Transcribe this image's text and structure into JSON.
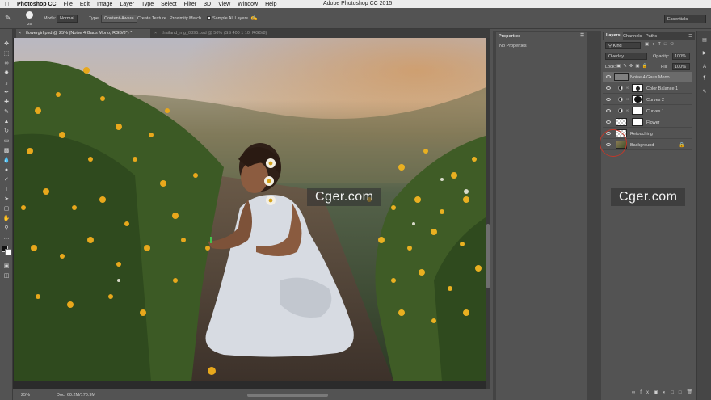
{
  "menubar": {
    "app_name": "Photoshop CC",
    "menus": [
      "File",
      "Edit",
      "Image",
      "Layer",
      "Type",
      "Select",
      "Filter",
      "3D",
      "View",
      "Window",
      "Help"
    ],
    "window_title": "Adobe Photoshop CC 2015"
  },
  "options": {
    "brush_size": "25",
    "mode_label": "Mode:",
    "mode_value": "Normal",
    "type_label": "Type:",
    "type_value": "Content-Aware",
    "create_texture": "Create Texture",
    "proximity_match": "Proximity Match",
    "sample_all_layers": "Sample All Layers",
    "workspace": "Essentials"
  },
  "tabs": [
    {
      "label": "flowergirl.psd @ 25% (Noise 4 Gaus Mono, RGB/8*) *",
      "active": true
    },
    {
      "label": "thailand_mg_0895.psd @ 50% (SS 400 1 10, RGB/8)",
      "active": false
    }
  ],
  "status": {
    "zoom": "25%",
    "doc": "Doc: 60.2M/170.9M"
  },
  "properties": {
    "title": "Properties",
    "empty_text": "No Properties"
  },
  "layers_panel": {
    "tabs": [
      "Layers",
      "Channels",
      "Paths"
    ],
    "kind_label": "Kind",
    "blend_mode": "Overlay",
    "opacity_label": "Opacity:",
    "opacity_value": "100%",
    "lock_label": "Lock:",
    "fill_label": "Fill:",
    "fill_value": "100%",
    "layers": [
      {
        "name": "Noise 4 Gaus Mono",
        "type": "pixel-gray",
        "selected": true
      },
      {
        "name": "Color Balance 1",
        "type": "adjustment"
      },
      {
        "name": "Curves 2",
        "type": "adjustment"
      },
      {
        "name": "Curves 1",
        "type": "adjustment"
      },
      {
        "name": "Flower",
        "type": "pixel-transparent"
      },
      {
        "name": "Retouching",
        "type": "pixel-transparent"
      },
      {
        "name": "Background",
        "type": "photo",
        "locked": true
      }
    ]
  },
  "watermark": "Cger.com",
  "colors": {
    "ui_gray": "#535353",
    "panel_dark": "#3e3e3e",
    "selected_layer": "#6b6b6b",
    "annotation_red": "#c0392b"
  }
}
